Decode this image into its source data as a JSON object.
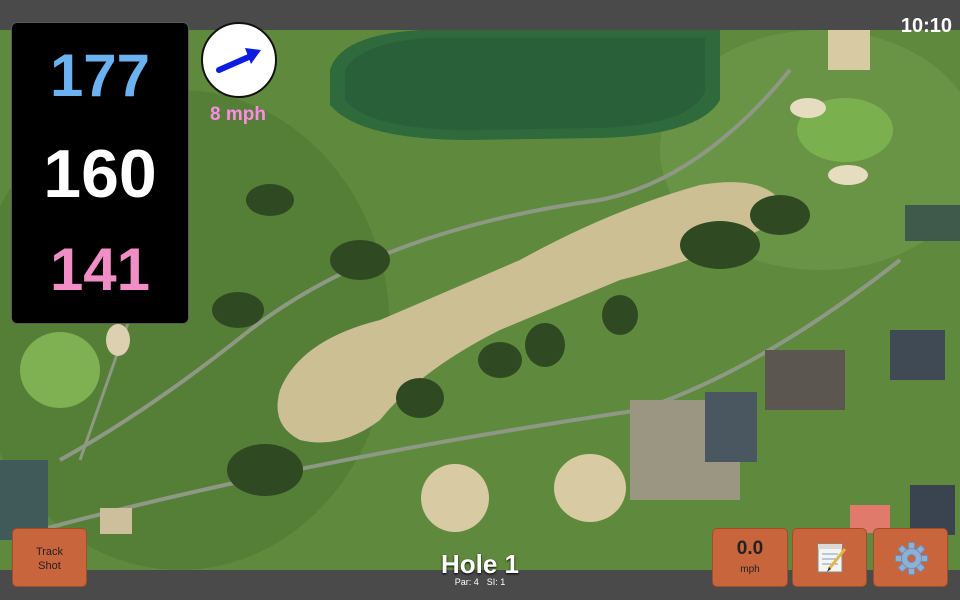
{
  "clock": "10:10",
  "distances": {
    "back": "177",
    "middle": "160",
    "front": "141"
  },
  "wind": {
    "speed_label": "8 mph",
    "direction_icon": "arrow-icon"
  },
  "hole": {
    "title": "Hole 1",
    "par_label": "Par: 4",
    "si_label": "SI: 1"
  },
  "buttons": {
    "track_shot_line1": "Track",
    "track_shot_line2": "Shot",
    "speed_value": "0.0",
    "speed_unit": "mph",
    "notes_icon": "notepad-icon",
    "settings_icon": "gear-icon"
  },
  "colors": {
    "back_distance": "#6cb2f0",
    "middle_distance": "#ffffff",
    "front_distance": "#f18ec6",
    "wind_text": "#ff8be6",
    "button_bg": "#c9653c"
  }
}
